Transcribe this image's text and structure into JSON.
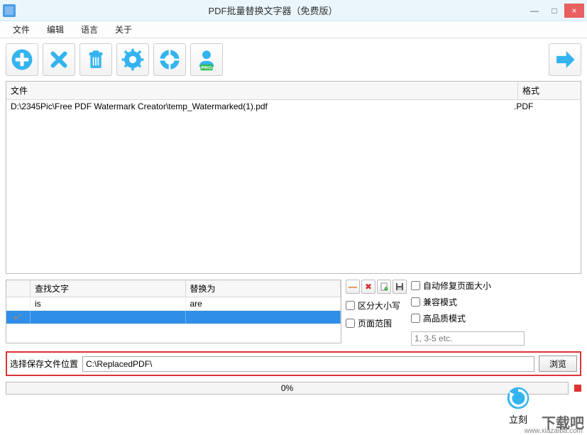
{
  "window": {
    "title": "PDF批量替换文字器（免费版）",
    "minimize": "—",
    "maximize": "□",
    "close": "×"
  },
  "menu": {
    "file": "文件",
    "edit": "编辑",
    "lang": "语言",
    "about": "关于"
  },
  "toolbar_icons": {
    "add": "add-icon",
    "remove": "remove-icon",
    "trash": "trash-icon",
    "settings": "gear-icon",
    "help": "lifebuoy-icon",
    "pro": "pro-icon",
    "next": "arrow-right-icon"
  },
  "file_table": {
    "headers": {
      "file": "文件",
      "format": "格式"
    },
    "rows": [
      {
        "file": "D:\\2345Pic\\Free PDF Watermark Creator\\temp_Watermarked(1).pdf",
        "format": ".PDF"
      }
    ]
  },
  "replace_table": {
    "headers": {
      "find": "查找文字",
      "replace": "替换为"
    },
    "rows": [
      {
        "find": "is",
        "replace": "are",
        "selected": false
      },
      {
        "find": "",
        "replace": "",
        "selected": true
      }
    ],
    "grip_new": "▸*"
  },
  "mini_tools": {
    "del_row": "—",
    "del_all": "✖",
    "open": "📄",
    "save": "💾"
  },
  "options": {
    "auto_fix": "自动修复页面大小",
    "compat": "兼容模式",
    "hq": "高品质模式",
    "case": "区分大小写",
    "page_range": "页面范围",
    "page_range_placeholder": "1, 3-5 etc."
  },
  "save": {
    "label": "选择保存文件位置",
    "path": "C:\\ReplacedPDF\\",
    "browse": "浏览"
  },
  "progress": {
    "percent": "0%"
  },
  "action": {
    "label": "立刻"
  },
  "watermark": {
    "main": "下载吧",
    "sub": "www.xiazaiba.com"
  }
}
